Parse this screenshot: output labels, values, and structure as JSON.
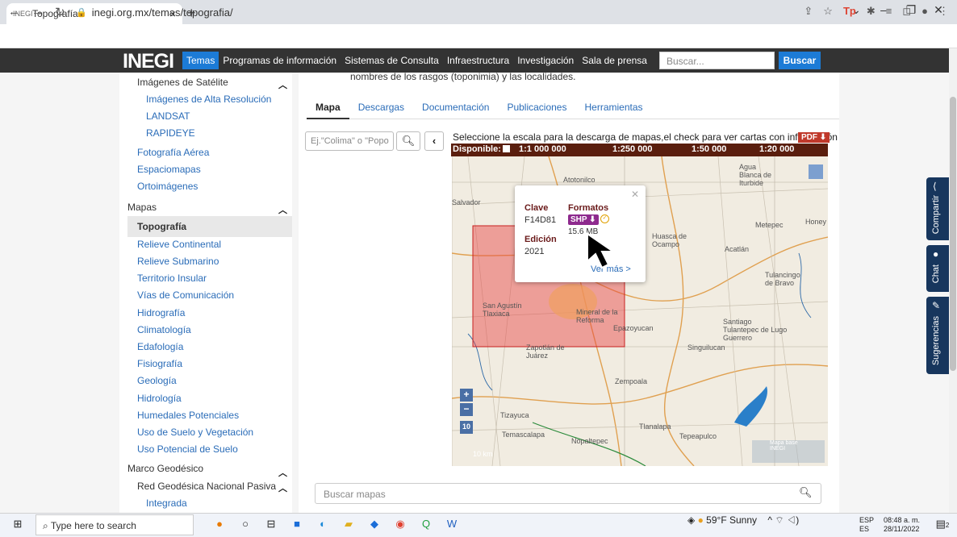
{
  "browser": {
    "tab_title": "Topografía",
    "favicon": "INEGI",
    "url": "inegi.org.mx/temas/topografia/"
  },
  "nav": {
    "logo": "INEGI",
    "items": [
      "Temas",
      "Programas de información",
      "Sistemas de Consulta",
      "Infraestructura",
      "Investigación",
      "Sala de prensa"
    ],
    "search_placeholder": "Buscar...",
    "search_button": "Buscar"
  },
  "sidebar": {
    "imagenes_satelite": "Imágenes de Satélite",
    "alta_resolucion": "Imágenes de Alta Resolución",
    "landsat": "LANDSAT",
    "rapideye": "RAPIDEYE",
    "fotografia_aerea": "Fotografía Aérea",
    "espaciomapas": "Espaciomapas",
    "ortoimagenes": "Ortoimágenes",
    "mapas": "Mapas",
    "topografia": "Topografía",
    "links": [
      "Relieve Continental",
      "Relieve Submarino",
      "Territorio Insular",
      "Vías de Comunicación",
      "Hidrografía",
      "Climatología",
      "Edafología",
      "Fisiografía",
      "Geología",
      "Hidrología",
      "Humedales Potenciales",
      "Uso de Suelo y Vegetación",
      "Uso Potencial de Suelo"
    ],
    "marco_geodesico": "Marco Geodésico",
    "red_geodesica": "Red Geodésica Nacional Pasiva",
    "integrada": "Integrada"
  },
  "content": {
    "intro": "nombres de los rasgos (toponimia) y las localidades.",
    "tabs": [
      "Mapa",
      "Descargas",
      "Documentación",
      "Publicaciones",
      "Herramientas"
    ],
    "map_search_placeholder": "Ej.\"Colima\" o \"Popo",
    "scale_instruction": "Seleccione la escala para la descarga de mapas,el check para ver cartas con información",
    "pdf_label": "PDF",
    "disponible": "Disponible:",
    "scales": [
      "1:1 000 000",
      "1:250 000",
      "1:50 000",
      "1:20 000"
    ],
    "bottom_search_placeholder": "Buscar mapas"
  },
  "popup": {
    "clave_label": "Clave",
    "clave_value": "F14D81",
    "formatos_label": "Formatos",
    "format_button": "SHP",
    "size": "15.6 MB",
    "edicion_label": "Edición",
    "edicion_value": "2021",
    "ver_mas": "Ver más >"
  },
  "map_labels": {
    "atotonilco": "Atotonilco",
    "agua_blanca": "Agua Blanca de Iturbide",
    "salvador": "Salvador",
    "metepec": "Metepec",
    "honey": "Honey",
    "huasca": "Huasca de Ocampo",
    "acatlan": "Acatlán",
    "tulancingo": "Tulancingo de Bravo",
    "san_agustin": "San Agustín Tlaxiaca",
    "mineral": "Mineral de la Reforma",
    "epazoyucan": "Epazoyucan",
    "santiago": "Santiago Tulantepec de Lugo Guerrero",
    "zapotlan": "Zapotlán de Juárez",
    "singuilucan": "Singuilucan",
    "zempoala": "Zempoala",
    "tizayuca": "Tizayuca",
    "tlanalapa": "Tlanalapa",
    "temascalapa": "Temascalapa",
    "nopaltepec": "Nopaltepec",
    "tepeapulco": "Tepeapulco",
    "scale_km": "10 km",
    "mapa_base": "Mapa base INEGI"
  },
  "side_widgets": [
    "Compartir",
    "Chat",
    "Sugerencias"
  ],
  "taskbar": {
    "search_placeholder": "Type here to search",
    "weather": "59°F Sunny",
    "lang_top": "ESP",
    "lang_bottom": "ES",
    "time": "08:48 a. m.",
    "date": "28/11/2022",
    "notif_count": "2"
  }
}
